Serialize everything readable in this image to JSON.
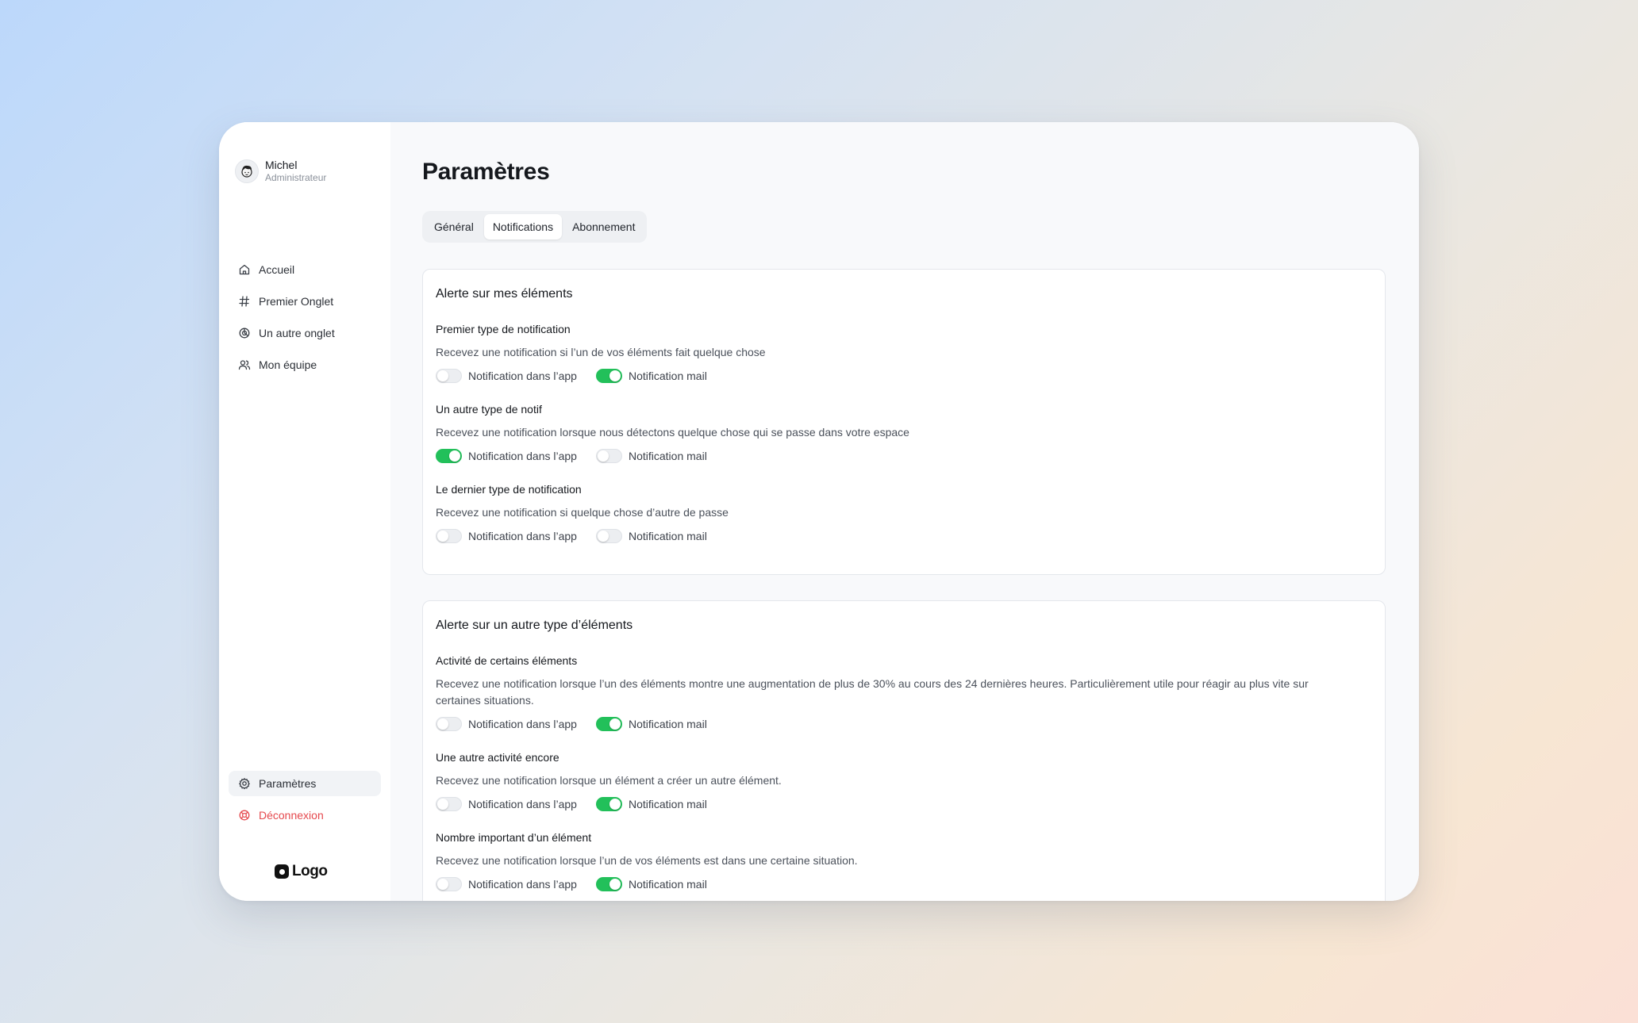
{
  "user": {
    "name": "Michel",
    "role": "Administrateur"
  },
  "nav": {
    "items": [
      {
        "label": "Accueil",
        "icon": "home-icon"
      },
      {
        "label": "Premier Onglet",
        "icon": "hash-icon"
      },
      {
        "label": "Un autre onglet",
        "icon": "chart-pie-icon"
      },
      {
        "label": "Mon équipe",
        "icon": "users-icon"
      }
    ],
    "settings_label": "Paramètres",
    "logout_label": "Déconnexion"
  },
  "logo": {
    "text": "Logo"
  },
  "page": {
    "title": "Paramètres"
  },
  "tabs": [
    {
      "label": "Général",
      "active": false
    },
    {
      "label": "Notifications",
      "active": true
    },
    {
      "label": "Abonnement",
      "active": false
    }
  ],
  "labels": {
    "in_app": "Notification dans l’app",
    "mail": "Notification mail"
  },
  "colors": {
    "accent_on": "#22c05a",
    "danger": "#e5484d"
  },
  "sections": [
    {
      "title": "Alerte sur mes éléments",
      "notifications": [
        {
          "title": "Premier type de notification",
          "description": "Recevez une notification si l’un de vos éléments fait quelque chose",
          "in_app": false,
          "mail": true
        },
        {
          "title": "Un autre type de notif",
          "description": "Recevez une notification lorsque nous détectons quelque chose qui se passe dans votre espace",
          "in_app": true,
          "mail": false
        },
        {
          "title": "Le dernier type de notification",
          "description": "Recevez une notification si quelque chose d’autre de passe",
          "in_app": false,
          "mail": false
        }
      ]
    },
    {
      "title": "Alerte sur un autre type d’éléments",
      "notifications": [
        {
          "title": "Activité de certains éléments",
          "description": "Recevez une notification lorsque l’un des éléments montre une augmentation de plus de 30% au cours des 24 dernières heures. Particulièrement utile pour réagir au plus vite sur certaines situations.",
          "in_app": false,
          "mail": true
        },
        {
          "title": "Une autre activité encore",
          "description": "Recevez une notification lorsque un élément a créer un autre élément.",
          "in_app": false,
          "mail": true
        },
        {
          "title": "Nombre important d’un élément",
          "description": "Recevez une notification lorsque l’un de vos éléments est dans une certaine situation.",
          "in_app": false,
          "mail": true
        }
      ]
    }
  ]
}
